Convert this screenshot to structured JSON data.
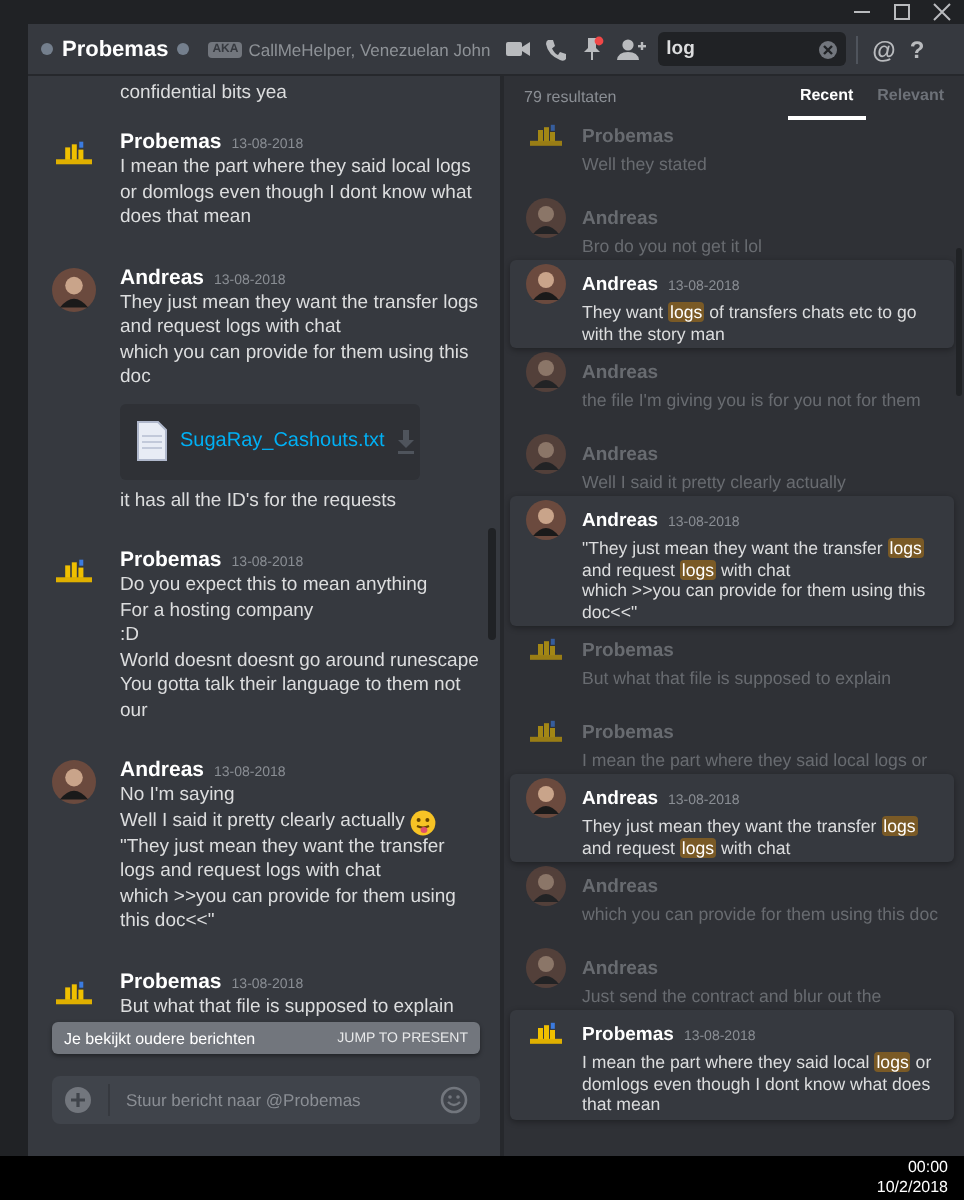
{
  "header": {
    "username": "Probemas",
    "aka_badge": "AKA",
    "aka_names": "CallMeHelper, Venezuelan John",
    "search": {
      "value": "log"
    },
    "mention_button": "@",
    "help_button": "?"
  },
  "chat": {
    "partial_top": "confidential bits yea",
    "messages": [
      {
        "author": "Probemas",
        "avatar": {
          "kind": "logo"
        },
        "date": "13-08-2018",
        "lines": [
          "I mean the part where they said local logs or domlogs even though I dont know what does that mean"
        ]
      },
      {
        "author": "Andreas",
        "avatar": {
          "kind": "person"
        },
        "date": "13-08-2018",
        "lines": [
          "They just mean they want the transfer logs and request logs with chat",
          "which you can provide for them using this doc"
        ],
        "attachment": {
          "filename": "SugaRay_Cashouts.txt"
        },
        "after": "it has all the ID's for the requests"
      },
      {
        "author": "Probemas",
        "avatar": {
          "kind": "logo"
        },
        "date": "13-08-2018",
        "lines": [
          "Do you expect this to mean anything",
          "For a hosting company",
          ":D",
          "World doesnt doesnt go around runescape",
          "You gotta talk their language to them not our"
        ]
      },
      {
        "author": "Andreas",
        "avatar": {
          "kind": "person"
        },
        "date": "13-08-2018",
        "lines": [
          "No I'm saying",
          {
            "text": "Well I said it pretty clearly actually",
            "emoji": true
          },
          "\"They just mean they want the transfer logs and request logs with chat",
          "which >>you can provide for them using this doc<<\""
        ]
      },
      {
        "author": "Probemas",
        "avatar": {
          "kind": "logo"
        },
        "date": "13-08-2018",
        "lines": [
          "But what that file is supposed to explain"
        ]
      }
    ],
    "banner": {
      "text": "Je bekijkt oudere berichten",
      "action": "JUMP TO PRESENT"
    },
    "composer": {
      "placeholder": "Stuur bericht naar @Probemas"
    }
  },
  "search_results": {
    "count": "79 resultaten",
    "tabs": [
      {
        "label": "Recent",
        "selected": true
      },
      {
        "label": "Relevant",
        "selected": false
      }
    ],
    "results": [
      {
        "kind": "context",
        "author": "Probemas",
        "avatar": {
          "kind": "logo"
        },
        "text": "Well they stated"
      },
      {
        "kind": "context",
        "author": "Andreas",
        "avatar": {
          "kind": "person"
        },
        "text": "Bro do you not get it lol"
      },
      {
        "kind": "hit",
        "author": "Andreas",
        "avatar": {
          "kind": "person"
        },
        "date": "13-08-2018",
        "text": "They want **logs** of transfers chats etc to go with the story man"
      },
      {
        "kind": "context",
        "author": "Andreas",
        "avatar": {
          "kind": "person"
        },
        "text": "the file I'm giving you is for you not for them"
      },
      {
        "kind": "context",
        "author": "Andreas",
        "avatar": {
          "kind": "person"
        },
        "text": "Well I said it pretty clearly actually"
      },
      {
        "kind": "hit",
        "author": "Andreas",
        "avatar": {
          "kind": "person"
        },
        "date": "13-08-2018",
        "text": "\"They just mean they want the transfer **logs** and request **logs** with chat\nwhich >>you can provide for them using this doc<<\""
      },
      {
        "kind": "context",
        "author": "Probemas",
        "avatar": {
          "kind": "logo"
        },
        "text": "But what that file is supposed to explain"
      },
      {
        "kind": "context",
        "author": "Probemas",
        "avatar": {
          "kind": "logo"
        },
        "text": "I mean the part where they said local logs or"
      },
      {
        "kind": "hit",
        "author": "Andreas",
        "avatar": {
          "kind": "person"
        },
        "date": "13-08-2018",
        "text": "They just mean they want the transfer **logs** and request **logs** with chat"
      },
      {
        "kind": "context",
        "author": "Andreas",
        "avatar": {
          "kind": "person"
        },
        "text": "which you can provide for them using this doc"
      },
      {
        "kind": "context",
        "author": "Andreas",
        "avatar": {
          "kind": "person"
        },
        "text": "Just send the contract and blur out the"
      },
      {
        "kind": "hit",
        "author": "Probemas",
        "avatar": {
          "kind": "logo"
        },
        "date": "13-08-2018",
        "text": "I mean the part where they said local **logs** or domlogs even though I dont know what does that mean"
      }
    ]
  },
  "taskbar": {
    "time": "00:00",
    "date": "10/2/2018"
  }
}
